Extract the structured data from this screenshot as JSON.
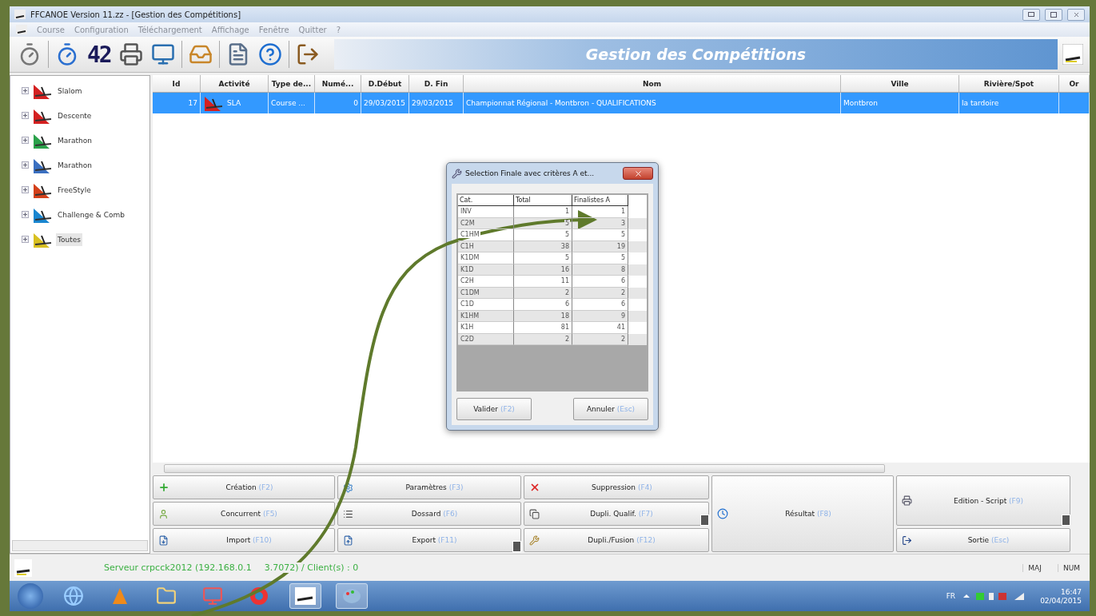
{
  "window": {
    "title": "FFCANOE Version 11.zz - [Gestion des Compétitions]"
  },
  "menu": [
    "Course",
    "Configuration",
    "Téléchargement",
    "Affichage",
    "Fenêtre",
    "Quitter",
    "?"
  ],
  "toolbar": {
    "counter": "42",
    "banner": "Gestion des Compétitions"
  },
  "tree": [
    {
      "label": "Slalom",
      "expanded": false,
      "selected": false
    },
    {
      "label": "Descente",
      "expanded": false,
      "selected": false
    },
    {
      "label": "Marathon",
      "expanded": false,
      "selected": false
    },
    {
      "label": "Marathon",
      "expanded": false,
      "selected": false
    },
    {
      "label": "FreeStyle",
      "expanded": false,
      "selected": false
    },
    {
      "label": "Challenge & Comb",
      "expanded": false,
      "selected": false
    },
    {
      "label": "Toutes",
      "expanded": false,
      "selected": true
    }
  ],
  "table": {
    "columns": [
      "Id",
      "Activité",
      "Type de...",
      "Numé...",
      "D.Début",
      "D. Fin",
      "Nom",
      "Ville",
      "Rivière/Spot",
      "Or"
    ],
    "rows": [
      {
        "selected": true,
        "cells": [
          "17",
          "SLA",
          "Course ...",
          "0",
          "29/03/2015",
          "29/03/2015",
          "Championnat Régional - Montbron - QUALIFICATIONS",
          "Montbron",
          "la tardoire"
        ]
      }
    ]
  },
  "dialog": {
    "title": "Selection Finale avec critères A et...",
    "columns": [
      "Cat.",
      "Total",
      "Finalistes A"
    ],
    "rows": [
      [
        "INV",
        "1",
        "1"
      ],
      [
        "C2M",
        "5",
        "3"
      ],
      [
        "C1HM",
        "5",
        "5"
      ],
      [
        "C1H",
        "38",
        "19"
      ],
      [
        "K1DM",
        "5",
        "5"
      ],
      [
        "K1D",
        "16",
        "8"
      ],
      [
        "C2H",
        "11",
        "6"
      ],
      [
        "C1DM",
        "2",
        "2"
      ],
      [
        "C1D",
        "6",
        "6"
      ],
      [
        "K1HM",
        "18",
        "9"
      ],
      [
        "K1H",
        "81",
        "41"
      ],
      [
        "C2D",
        "2",
        "2"
      ]
    ],
    "buttons": [
      {
        "label": "Valider",
        "shortcut": "(F2)"
      },
      {
        "label": "Annuler",
        "shortcut": "(Esc)"
      }
    ]
  },
  "actions": [
    {
      "label": "Création",
      "shortcut": "(F2)",
      "dropdown": false
    },
    {
      "label": "Concurrent",
      "shortcut": "(F5)",
      "dropdown": false
    },
    {
      "label": "Import",
      "shortcut": "(F10)",
      "dropdown": false
    },
    {
      "label": "Paramètres",
      "shortcut": "(F3)",
      "dropdown": false
    },
    {
      "label": "Dossard",
      "shortcut": "(F6)",
      "dropdown": false
    },
    {
      "label": "Export",
      "shortcut": "(F11)",
      "dropdown": true
    },
    {
      "label": "Suppression",
      "shortcut": "(F4)",
      "dropdown": false
    },
    {
      "label": "Dupli. Qualif.",
      "shortcut": "(F7)",
      "dropdown": true
    },
    {
      "label": "Dupli./Fusion",
      "shortcut": "(F12)",
      "dropdown": false
    },
    {
      "label": "Résultat",
      "shortcut": "(F8)",
      "dropdown": false
    },
    {
      "label": "Edition - Script",
      "shortcut": "(F9)",
      "dropdown": true
    },
    {
      "label": "Sortie",
      "shortcut": "(Esc)",
      "dropdown": false
    }
  ],
  "status_bar": {
    "server": [
      "Serveur crpcck2012 (192.168.0.1",
      "3.7072) / Client(s) : 0"
    ],
    "indicators": [
      "MAJ",
      "NUM"
    ]
  },
  "taskbar": {
    "language": "FR",
    "time": "16:47",
    "date": "02/04/2015"
  }
}
